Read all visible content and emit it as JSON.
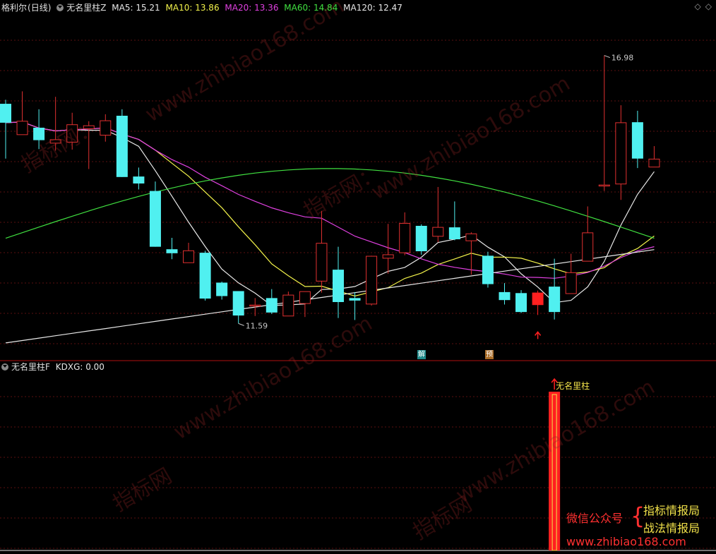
{
  "main_header": {
    "stock_name": "格利尔",
    "period": "(日线)",
    "indicator": "无名里柱Z",
    "ma": [
      {
        "label": "MA5: 15.21",
        "color": "#e8e8e8"
      },
      {
        "label": "MA10: 13.86",
        "color": "#f2f24a"
      },
      {
        "label": "MA20: 13.36",
        "color": "#e040e0"
      },
      {
        "label": "MA60: 14.84",
        "color": "#40e040"
      },
      {
        "label": "MA120: 12.47",
        "color": "#e8e8e8"
      }
    ]
  },
  "sub_header": {
    "indicator": "无名里柱F",
    "value_label": "KDXG: 0.00"
  },
  "window_icons": [
    "◇",
    "◇"
  ],
  "badges": [
    {
      "text": "解",
      "color": "#1e8a8a"
    },
    {
      "text": "预",
      "color": "#a86a24"
    }
  ],
  "watermarks": [
    "www.zhibiao168.com",
    "指标网：",
    "指标网"
  ],
  "promo": {
    "wechat": "微信公众号",
    "brace": "{",
    "line1": "指标情报局",
    "line2": "战法情报局",
    "url": "www.zhibiao168.com"
  },
  "colors": {
    "up": "#e03030",
    "down": "#50f0f0",
    "signal": "#ff2020",
    "grid": "#5a1010"
  },
  "chart_data": {
    "type": "candlestick",
    "ylim": [
      11.0,
      17.8
    ],
    "max_label": "16.98",
    "min_label": "11.59",
    "signal_index": 32,
    "signal_label": "无名里柱",
    "candles": [
      {
        "o": 16.0,
        "c": 15.62,
        "h": 16.08,
        "l": 14.9
      },
      {
        "o": 15.38,
        "c": 15.65,
        "h": 16.25,
        "l": 15.38
      },
      {
        "o": 15.52,
        "c": 15.27,
        "h": 15.89,
        "l": 15.09
      },
      {
        "o": 15.21,
        "c": 15.28,
        "h": 16.14,
        "l": 15.06
      },
      {
        "o": 15.23,
        "c": 15.58,
        "h": 15.82,
        "l": 15.08
      },
      {
        "o": 15.5,
        "c": 15.56,
        "h": 15.65,
        "l": 14.69
      },
      {
        "o": 15.37,
        "c": 15.66,
        "h": 15.79,
        "l": 15.24
      },
      {
        "o": 15.76,
        "c": 14.53,
        "h": 15.89,
        "l": 14.53
      },
      {
        "o": 14.54,
        "c": 14.4,
        "h": 14.72,
        "l": 14.28
      },
      {
        "o": 14.25,
        "c": 13.13,
        "h": 14.44,
        "l": 13.13
      },
      {
        "o": 13.08,
        "c": 13.0,
        "h": 13.31,
        "l": 12.88
      },
      {
        "o": 12.81,
        "c": 13.05,
        "h": 13.21,
        "l": 12.81
      },
      {
        "o": 13.01,
        "c": 12.09,
        "h": 13.05,
        "l": 12.05
      },
      {
        "o": 12.41,
        "c": 12.14,
        "h": 12.43,
        "l": 12.07
      },
      {
        "o": 12.24,
        "c": 11.75,
        "h": 12.24,
        "l": 11.59
      },
      {
        "o": 11.96,
        "c": 11.96,
        "h": 12.1,
        "l": 11.74
      },
      {
        "o": 12.1,
        "c": 11.81,
        "h": 12.28,
        "l": 11.78
      },
      {
        "o": 11.74,
        "c": 12.16,
        "h": 12.23,
        "l": 11.74
      },
      {
        "o": 11.99,
        "c": 12.23,
        "h": 12.22,
        "l": 11.72
      },
      {
        "o": 12.44,
        "c": 13.2,
        "h": 13.85,
        "l": 12.21
      },
      {
        "o": 12.67,
        "c": 12.02,
        "h": 13.13,
        "l": 11.7
      },
      {
        "o": 12.1,
        "c": 12.05,
        "h": 12.22,
        "l": 11.66
      },
      {
        "o": 11.98,
        "c": 12.94,
        "h": 12.95,
        "l": 11.95
      },
      {
        "o": 12.9,
        "c": 12.97,
        "h": 13.59,
        "l": 12.59
      },
      {
        "o": 13.01,
        "c": 13.6,
        "h": 13.82,
        "l": 12.96
      },
      {
        "o": 13.55,
        "c": 13.04,
        "h": 13.58,
        "l": 12.97
      },
      {
        "o": 13.34,
        "c": 13.52,
        "h": 14.33,
        "l": 13.22
      },
      {
        "o": 13.52,
        "c": 13.28,
        "h": 14.04,
        "l": 13.26
      },
      {
        "o": 13.25,
        "c": 13.39,
        "h": 13.42,
        "l": 12.57
      },
      {
        "o": 12.95,
        "c": 12.38,
        "h": 13.03,
        "l": 12.31
      },
      {
        "o": 12.22,
        "c": 12.06,
        "h": 12.4,
        "l": 11.97
      },
      {
        "o": 12.2,
        "c": 11.82,
        "h": 12.26,
        "l": 11.8
      },
      {
        "o": 12.21,
        "c": 11.96,
        "h": 12.25,
        "l": 11.76
      },
      {
        "o": 12.33,
        "c": 11.82,
        "h": 12.89,
        "l": 11.67
      },
      {
        "o": 12.19,
        "c": 12.61,
        "h": 12.99,
        "l": 12.2
      },
      {
        "o": 12.84,
        "c": 13.41,
        "h": 13.94,
        "l": 12.98
      },
      {
        "o": 14.35,
        "c": 14.37,
        "h": 16.97,
        "l": 14.25
      },
      {
        "o": 14.39,
        "c": 15.62,
        "h": 15.97,
        "l": 14.07
      },
      {
        "o": 15.63,
        "c": 14.9,
        "h": 15.86,
        "l": 14.71
      },
      {
        "o": 14.73,
        "c": 14.89,
        "h": 15.15,
        "l": 14.73
      }
    ],
    "indicator": {
      "name": "KDXG",
      "values": [
        0,
        0,
        0,
        0,
        0,
        0,
        0,
        0,
        0,
        0,
        0,
        0,
        0,
        0,
        0,
        0,
        0,
        0,
        0,
        0,
        0,
        0,
        0,
        0,
        0,
        0,
        0,
        0,
        0,
        0,
        0,
        0,
        0,
        1,
        0,
        0,
        0,
        0,
        0,
        0
      ]
    }
  }
}
